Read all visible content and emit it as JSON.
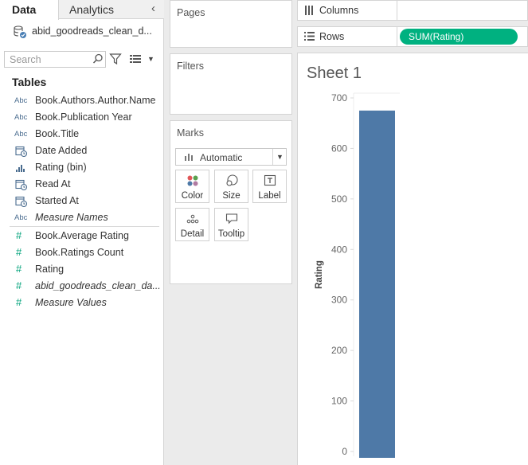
{
  "data_pane": {
    "tabs": {
      "data": "Data",
      "analytics": "Analytics"
    },
    "datasource": "abid_goodreads_clean_d...",
    "search": {
      "placeholder": "Search",
      "value": ""
    },
    "tables_heading": "Tables",
    "dimensions": [
      {
        "type": "Abc",
        "label": "Book.Authors.Author.Name"
      },
      {
        "type": "Abc",
        "label": "Book.Publication Year"
      },
      {
        "type": "Abc",
        "label": "Book.Title"
      },
      {
        "type": "date",
        "label": "Date Added"
      },
      {
        "type": "bin",
        "label": "Rating (bin)"
      },
      {
        "type": "date",
        "label": "Read At"
      },
      {
        "type": "date",
        "label": "Started At"
      },
      {
        "type": "Abc",
        "label": "Measure Names",
        "italic": true
      }
    ],
    "measures": [
      {
        "type": "#",
        "label": "Book.Average Rating"
      },
      {
        "type": "#",
        "label": "Book.Ratings Count"
      },
      {
        "type": "#",
        "label": "Rating"
      },
      {
        "type": "#",
        "label": "abid_goodreads_clean_da...",
        "italic": true
      },
      {
        "type": "#",
        "label": "Measure Values",
        "italic": true
      }
    ]
  },
  "cards": {
    "pages": "Pages",
    "filters": "Filters",
    "marks": {
      "title": "Marks",
      "mark_type": "Automatic",
      "buttons": [
        "Color",
        "Size",
        "Label",
        "Detail",
        "Tooltip"
      ]
    }
  },
  "shelves": {
    "columns": {
      "label": "Columns"
    },
    "rows": {
      "label": "Rows",
      "pill": "SUM(Rating)"
    }
  },
  "sheet": {
    "title": "Sheet 1"
  },
  "colors": {
    "bar": "#4e79a7",
    "pill": "#00b180",
    "dimension_icon": "#4a6c8f",
    "measure_icon": "#00a27a"
  },
  "chart_data": {
    "type": "bar",
    "categories": [
      ""
    ],
    "values": [
      675
    ],
    "title": "",
    "xlabel": "",
    "ylabel": "Rating",
    "ylim": [
      0,
      700
    ],
    "yticks": [
      0,
      100,
      200,
      300,
      400,
      500,
      600,
      700
    ],
    "grid": false,
    "legend": "none"
  }
}
